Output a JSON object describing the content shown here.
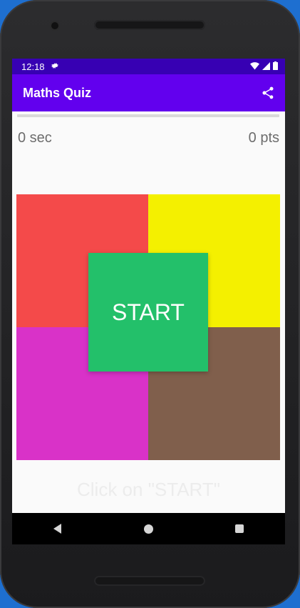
{
  "status_bar": {
    "time": "12:18",
    "icons": [
      "settings-gear-icon",
      "wifi-icon",
      "signal-icon",
      "battery-icon"
    ]
  },
  "app_bar": {
    "title": "Maths Quiz",
    "action_icon": "share-icon"
  },
  "quiz": {
    "progress_fraction": 0,
    "timer_text": "0 sec",
    "score_text": "0 pts",
    "start_label": "START",
    "hint_text": "Click on \"START\"",
    "tiles": [
      {
        "position": "top-left",
        "color": "#f44a4a"
      },
      {
        "position": "top-right",
        "color": "#f4f000"
      },
      {
        "position": "bottom-left",
        "color": "#d932c8"
      },
      {
        "position": "bottom-right",
        "color": "#805f4c"
      }
    ],
    "start_color": "#23c06a"
  },
  "colors": {
    "status_bar": "#3700b3",
    "app_bar": "#6200ee",
    "background": "#fafafa"
  },
  "nav_bar": {
    "buttons": [
      "back-icon",
      "home-icon",
      "recents-icon"
    ]
  }
}
